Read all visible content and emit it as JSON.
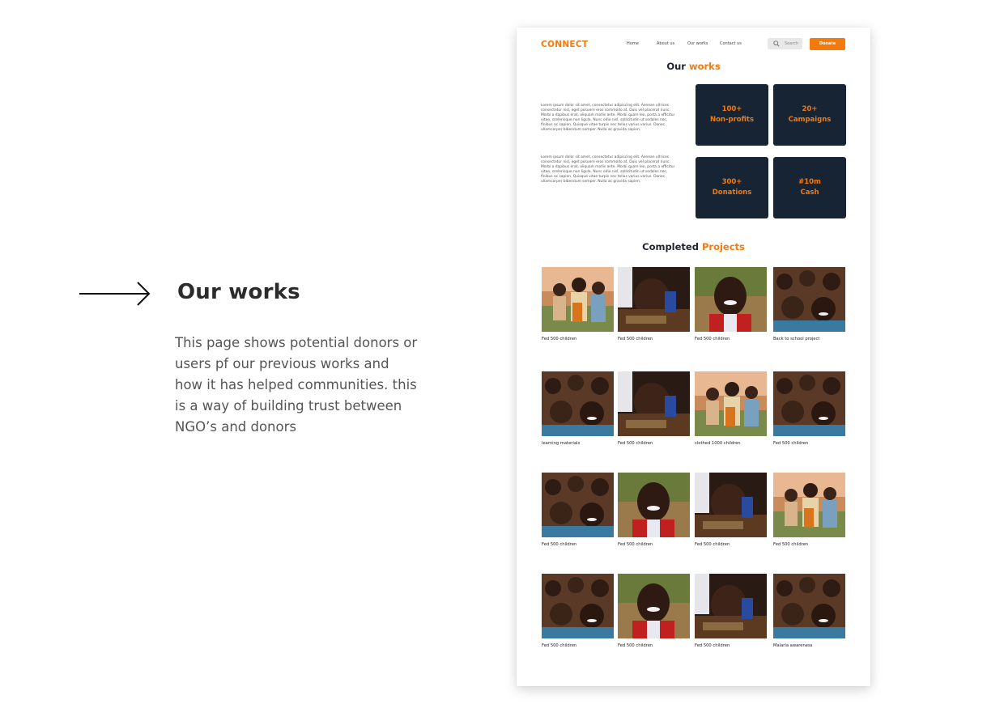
{
  "annotation": {
    "title": "Our works",
    "description": "This page shows potential donors or users pf our previous works and how it has helped communities. this is a way of building trust between NGO’s and donors"
  },
  "header": {
    "logo": "CONNECT",
    "nav": [
      "Home",
      "About us",
      "Our works",
      "Contact us"
    ],
    "search_label": "Search",
    "donate_label": "Donate"
  },
  "works_section": {
    "title_plain": "Our",
    "title_accent": "works",
    "paragraphs": [
      "Lorem ipsum dolor sit amet, consectetur adipiscing elit. Aenean ultrices consectetur nisl, eget posuere eros commodo at. Duis vel placerat nunc. Morbi a dapibus erat, aliquam mollis ante. Morbi quam leo, porta a efficitur vitae, scelerisque non ligula. Nunc odio nisl, sollicitudin ut sodales nec, finibus ac sapien. Quisque vitae turpis nec tellus varius varius. Donec ullamcorper bibendum semper. Nulla ac gravida sapien.",
      "Lorem ipsum dolor sit amet, consectetur adipiscing elit. Aenean ultrices consectetur nisl, eget posuere eros commodo at. Duis vel placerat nunc. Morbi a dapibus erat, aliquam mollis ante. Morbi quam leo, porta a efficitur vitae, scelerisque non ligula. Nunc odio nisl, sollicitudin ut sodales nec, finibus ac sapien. Quisque vitae turpis nec tellus varius varius. Donec ullamcorper bibendum semper. Nulla ac gravida sapien."
    ],
    "stats": [
      {
        "line1": "100+",
        "line2": "Non-profits"
      },
      {
        "line1": "20+",
        "line2": "Campaigns"
      },
      {
        "line1": "300+",
        "line2": "Donations"
      },
      {
        "line1": "#10m",
        "line2": "Cash"
      }
    ]
  },
  "projects_section": {
    "title_plain": "Completed",
    "title_accent": "Projects",
    "projects": [
      {
        "caption": "Fed 500 children",
        "photo": "group-outdoor-photo"
      },
      {
        "caption": "Fed 500 children",
        "photo": "child-at-desk-photo"
      },
      {
        "caption": "Fed 500 children",
        "photo": "smiling-boy-photo"
      },
      {
        "caption": "Back to school project",
        "photo": "crowd-children-photo"
      },
      {
        "caption": "learning materials",
        "photo": "crowd-children-photo"
      },
      {
        "caption": "Fed 500 children",
        "photo": "child-at-desk-photo"
      },
      {
        "caption": "clothed 1000 children",
        "photo": "group-outdoor-photo"
      },
      {
        "caption": "Fed 500 children",
        "photo": "crowd-children-photo"
      },
      {
        "caption": "Fed 500 children",
        "photo": "crowd-children-photo"
      },
      {
        "caption": "Fed 500 children",
        "photo": "smiling-boy-photo"
      },
      {
        "caption": "Fed 500 children",
        "photo": "child-at-desk-photo"
      },
      {
        "caption": "Fed 500 children",
        "photo": "group-outdoor-photo"
      },
      {
        "caption": "Fed 500 children",
        "photo": "crowd-children-photo"
      },
      {
        "caption": "Fed 500 children",
        "photo": "smiling-boy-photo"
      },
      {
        "caption": "Fed 500 children",
        "photo": "child-at-desk-photo"
      },
      {
        "caption": "Malaria awareness",
        "photo": "crowd-children-photo"
      }
    ]
  },
  "colors": {
    "accent": "#f47a0c",
    "stat_card": "#162433",
    "heading": "#1d2330"
  }
}
